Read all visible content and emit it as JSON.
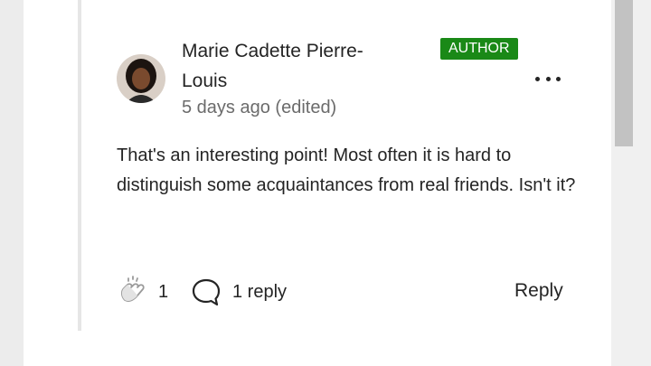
{
  "comment": {
    "author": "Marie Cadette Pierre-Louis",
    "badge": "AUTHOR",
    "timestamp": "5 days ago (edited)",
    "body": "That's an interesting point! Most often it is hard to distinguish some acquaintances from real friends. Isn't it?",
    "claps": "1",
    "replies_label": "1 reply",
    "reply_label": "Reply"
  },
  "icons": {
    "avatar": "avatar",
    "menu": "more-horizontal-icon",
    "clap": "clap-icon",
    "reply": "speech-bubble-icon"
  },
  "colors": {
    "badge_bg": "#1a8917",
    "text": "#242424",
    "muted": "#6b6b6b"
  }
}
